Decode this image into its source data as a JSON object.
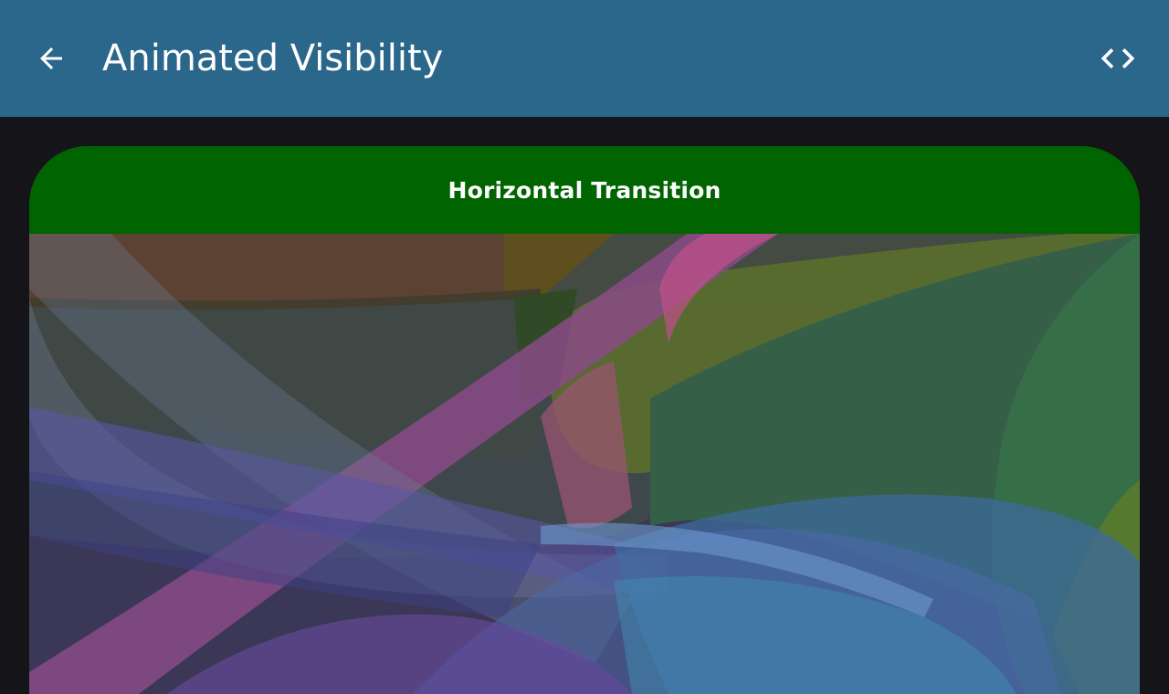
{
  "app_bar": {
    "title": "Animated Visibility",
    "back_icon": "arrow-back-icon",
    "code_icon": "code-icon",
    "background": "#2b668b"
  },
  "card": {
    "title": "Horizontal Transition",
    "header_color": "#006400"
  },
  "colors": {
    "page_background": "#141419",
    "on_surface": "#ffffff"
  }
}
